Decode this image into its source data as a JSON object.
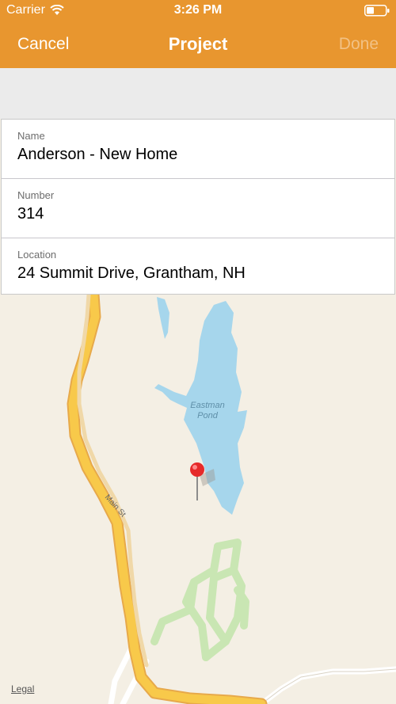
{
  "status": {
    "carrier": "Carrier",
    "time": "3:26 PM"
  },
  "nav": {
    "cancel": "Cancel",
    "title": "Project",
    "done": "Done"
  },
  "form": {
    "fields": [
      {
        "label": "Name",
        "value": "Anderson - New Home"
      },
      {
        "label": "Number",
        "value": "314"
      },
      {
        "label": "Location",
        "value": "24 Summit Drive, Grantham, NH"
      }
    ]
  },
  "map": {
    "lake_label_1": "Eastman",
    "lake_label_2": "Pond",
    "road_label": "Main St",
    "legal": "Legal"
  },
  "colors": {
    "nav_bg": "#e8962f",
    "done_disabled": "#f2c184",
    "map_bg": "#f4efe4",
    "water": "#a6d6ec",
    "road": "#f8c94a",
    "park": "#c9e6b3"
  }
}
